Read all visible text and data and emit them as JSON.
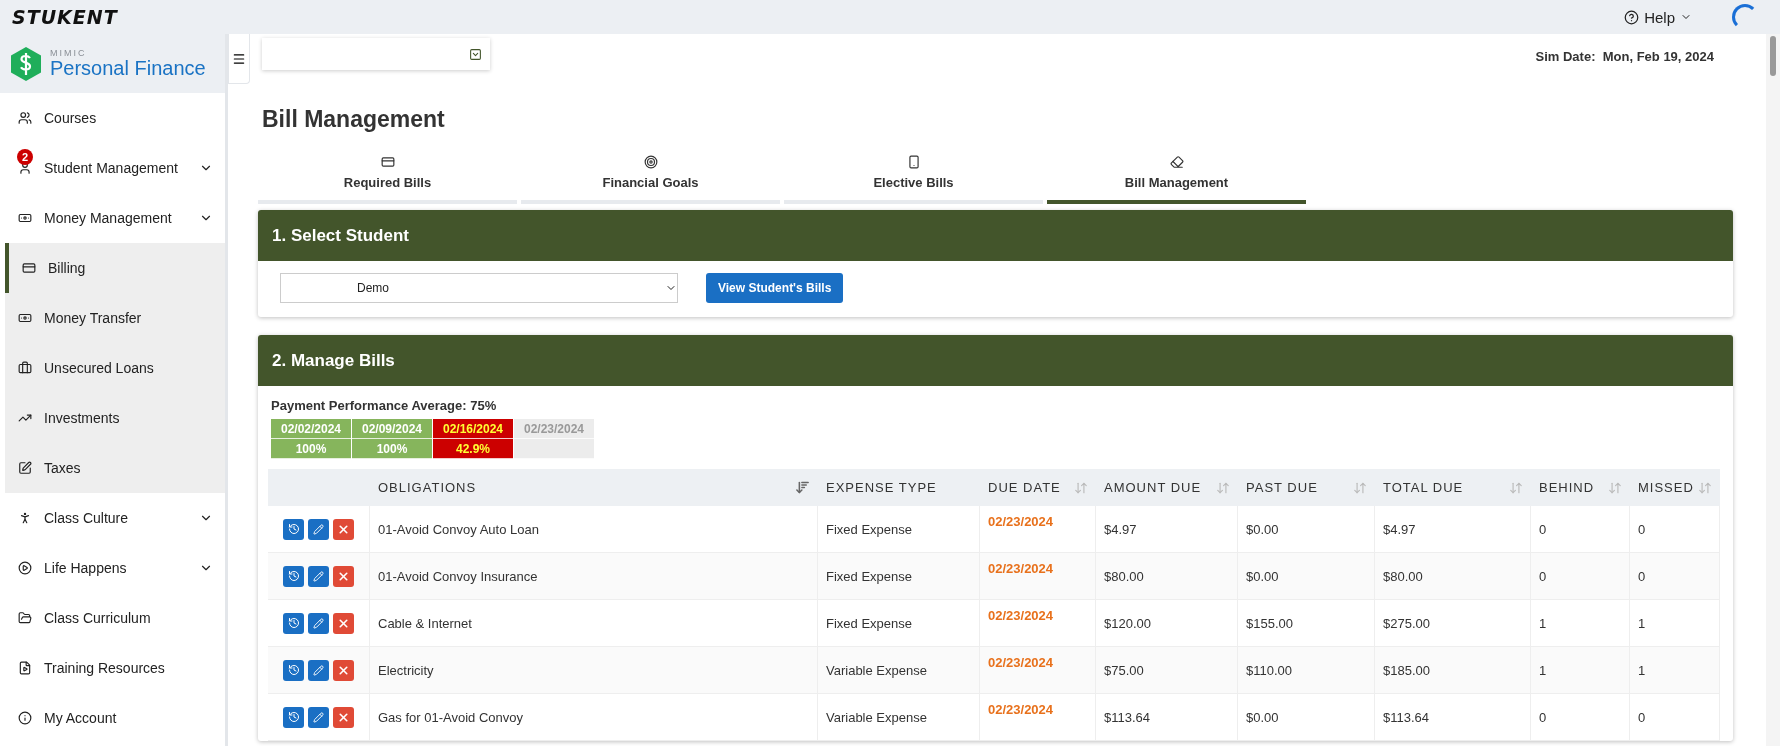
{
  "top_bar": {
    "logo": "STUKENT",
    "help": "Help"
  },
  "sidebar": {
    "brand_small": "MIMIC",
    "brand": "Personal Finance",
    "items": [
      {
        "label": "Courses",
        "expandable": false
      },
      {
        "label": "Student Management",
        "expandable": true,
        "badge": "2"
      },
      {
        "label": "Money Management",
        "expandable": true,
        "children": [
          {
            "label": "Billing",
            "selected": true
          },
          {
            "label": "Money Transfer",
            "selected": false
          },
          {
            "label": "Unsecured Loans",
            "selected": false
          },
          {
            "label": "Investments",
            "selected": false
          },
          {
            "label": "Taxes",
            "selected": false
          }
        ]
      },
      {
        "label": "Class Culture",
        "expandable": true
      },
      {
        "label": "Life Happens",
        "expandable": true
      },
      {
        "label": "Class Curriculum",
        "expandable": false
      },
      {
        "label": "Training Resources",
        "expandable": false
      },
      {
        "label": "My Account",
        "expandable": false
      }
    ]
  },
  "header": {
    "sim_date_label": "Sim Date:",
    "sim_date": "Mon, Feb 19, 2024"
  },
  "page_title": "Bill Management",
  "tabs": [
    {
      "label": "Required Bills",
      "selected": false
    },
    {
      "label": "Financial Goals",
      "selected": false
    },
    {
      "label": "Elective Bills",
      "selected": false
    },
    {
      "label": "Bill Management",
      "selected": true
    }
  ],
  "select_student": {
    "title": "1. Select Student",
    "student": "Demo",
    "button": "View Student's Bills"
  },
  "manage_bills": {
    "title": "2. Manage Bills",
    "performance": "Payment Performance Average: 75%",
    "weeks": [
      {
        "date": "02/02/2024",
        "percent": "100%",
        "kind": "good"
      },
      {
        "date": "02/09/2024",
        "percent": "100%",
        "kind": "good"
      },
      {
        "date": "02/16/2024",
        "percent": "42.9%",
        "kind": "bad"
      },
      {
        "date": "02/23/2024",
        "kind": "pending"
      }
    ],
    "table": {
      "columns": [
        {
          "label": "OBLIGATIONS",
          "sortable": true,
          "sorted": true
        },
        {
          "label": "EXPENSE TYPE",
          "sortable": false,
          "sorted": false
        },
        {
          "label": "DUE DATE",
          "sortable": true,
          "sorted": false
        },
        {
          "label": "AMOUNT DUE",
          "sortable": true,
          "sorted": false
        },
        {
          "label": "PAST DUE",
          "sortable": true,
          "sorted": false
        },
        {
          "label": "TOTAL DUE",
          "sortable": true,
          "sorted": false
        },
        {
          "label": "BEHIND",
          "sortable": true,
          "sorted": false
        },
        {
          "label": "MISSED",
          "sortable": true,
          "sorted": false
        }
      ],
      "rows": [
        [
          "01-Avoid Convoy Auto Loan",
          "Fixed Expense",
          "02/23/2024",
          "$4.97",
          "$0.00",
          "$4.97",
          "0",
          "0"
        ],
        [
          "01-Avoid Convoy Insurance",
          "Fixed Expense",
          "02/23/2024",
          "$80.00",
          "$0.00",
          "$80.00",
          "0",
          "0"
        ],
        [
          "Cable & Internet",
          "Fixed Expense",
          "02/23/2024",
          "$120.00",
          "$155.00",
          "$275.00",
          "1",
          "1"
        ],
        [
          "Electricity",
          "Variable Expense",
          "02/23/2024",
          "$75.00",
          "$110.00",
          "$185.00",
          "1",
          "1"
        ],
        [
          "Gas for 01-Avoid Convoy",
          "Variable Expense",
          "02/23/2024",
          "$113.64",
          "$0.00",
          "$113.64",
          "0",
          "0"
        ]
      ]
    }
  }
}
